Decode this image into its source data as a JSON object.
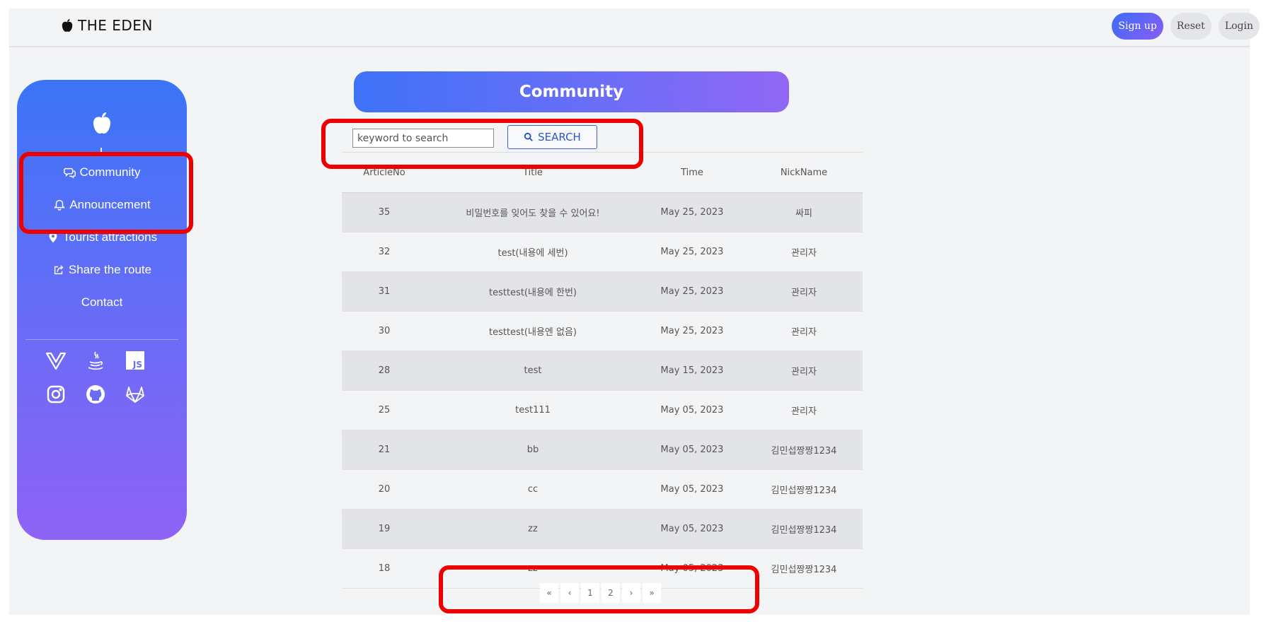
{
  "header": {
    "brand": "THE EDEN",
    "sign_up": "Sign up",
    "reset": "Reset",
    "login": "Login"
  },
  "sidebar": {
    "items": [
      {
        "label": "Community",
        "icon": "chat-icon"
      },
      {
        "label": "Announcement",
        "icon": "bell-icon"
      },
      {
        "label": "Tourist attractions",
        "icon": "map-pin-icon"
      },
      {
        "label": "Share the route",
        "icon": "share-icon"
      },
      {
        "label": "Contact",
        "icon": ""
      }
    ],
    "social_icons": [
      "vue-icon",
      "java-icon",
      "js-icon",
      "instagram-icon",
      "github-icon",
      "gitlab-icon"
    ]
  },
  "main": {
    "title": "Community",
    "search": {
      "placeholder": "keyword to search",
      "value": "",
      "button_label": "SEARCH"
    },
    "table": {
      "headers": [
        "ArticleNo",
        "Title",
        "Time",
        "NickName"
      ],
      "rows": [
        [
          "35",
          "비밀번호를 잊어도 찾을 수 있어요!",
          "May 25, 2023",
          "싸피"
        ],
        [
          "32",
          "test(내용에 세번)",
          "May 25, 2023",
          "관리자"
        ],
        [
          "31",
          "testtest(내용에 한번)",
          "May 25, 2023",
          "관리자"
        ],
        [
          "30",
          "testtest(내용엔 없음)",
          "May 25, 2023",
          "관리자"
        ],
        [
          "28",
          "test",
          "May 15, 2023",
          "관리자"
        ],
        [
          "25",
          "test111",
          "May 05, 2023",
          "관리자"
        ],
        [
          "21",
          "bb",
          "May 05, 2023",
          "김민섭짱짱1234"
        ],
        [
          "20",
          "cc",
          "May 05, 2023",
          "김민섭짱짱1234"
        ],
        [
          "19",
          "zz",
          "May 05, 2023",
          "김민섭짱짱1234"
        ],
        [
          "18",
          "zz",
          "May 05, 2023",
          "김민섭짱짱1234"
        ]
      ]
    },
    "pagination": [
      "«",
      "‹",
      "1",
      "2",
      "›",
      "»"
    ]
  },
  "colors": {
    "accent_start": "#3b74f7",
    "accent_end": "#8e63f6",
    "highlight": "#ee0000"
  }
}
